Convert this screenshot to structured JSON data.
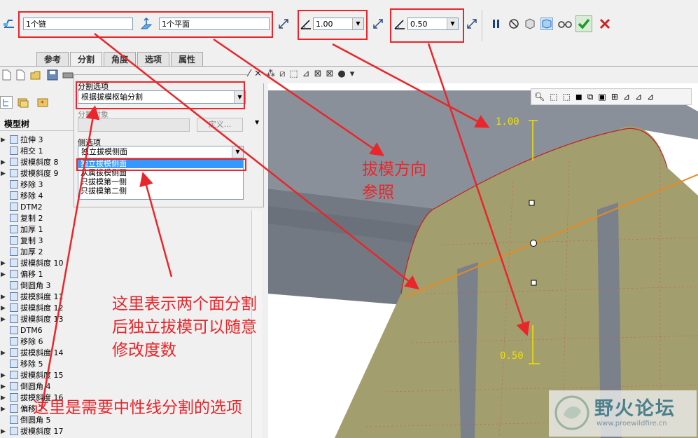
{
  "dashboard": {
    "chain_field": "1个链",
    "plane_field": "1个平面",
    "angle1": "1.00",
    "angle2": "0.50"
  },
  "tabs": [
    {
      "label": "参考"
    },
    {
      "label": "分割"
    },
    {
      "label": "角度"
    },
    {
      "label": "选项"
    },
    {
      "label": "属性"
    }
  ],
  "split_panel": {
    "split_options_label": "分割选项",
    "split_options_value": "根据拔模枢轴分割",
    "split_object_label": "分割对象",
    "define_button": "定义...",
    "side_options_label": "侧选项",
    "side_options_value": "独立拔模侧面",
    "side_options_list": [
      "独立拔模侧面",
      "从属拔模侧面",
      "只拔模第一侧",
      "只拔模第二侧"
    ]
  },
  "model_tree": {
    "title": "模型树",
    "items": [
      {
        "label": "拉伸 3",
        "expandable": true
      },
      {
        "label": "相交 1",
        "expandable": false
      },
      {
        "label": "拔模斜度 8",
        "expandable": true
      },
      {
        "label": "拔模斜度 9",
        "expandable": true
      },
      {
        "label": "移除 3",
        "expandable": false
      },
      {
        "label": "移除 4",
        "expandable": false
      },
      {
        "label": "DTM2",
        "expandable": false
      },
      {
        "label": "复制 2",
        "expandable": false
      },
      {
        "label": "加厚 1",
        "expandable": false
      },
      {
        "label": "复制 3",
        "expandable": false
      },
      {
        "label": "加厚 2",
        "expandable": false
      },
      {
        "label": "拔模斜度 10",
        "expandable": true
      },
      {
        "label": "偏移 1",
        "expandable": true
      },
      {
        "label": "倒圆角 3",
        "expandable": false
      },
      {
        "label": "拔模斜度 11",
        "expandable": true
      },
      {
        "label": "拔模斜度 12",
        "expandable": true
      },
      {
        "label": "拔模斜度 13",
        "expandable": true
      },
      {
        "label": "DTM6",
        "expandable": false
      },
      {
        "label": "移除 6",
        "expandable": false
      },
      {
        "label": "拔模斜度 14",
        "expandable": true
      },
      {
        "label": "移除 5",
        "expandable": false
      },
      {
        "label": "拔模斜度 15",
        "expandable": true
      },
      {
        "label": "倒圆角 4",
        "expandable": true
      },
      {
        "label": "拔模斜度 16",
        "expandable": true
      },
      {
        "label": "偏移 2",
        "expandable": true
      },
      {
        "label": "倒圆角 5",
        "expandable": false
      },
      {
        "label": "拔模斜度 17",
        "expandable": true
      }
    ]
  },
  "viewport": {
    "dim_top": "1.00",
    "dim_bottom": "0.50"
  },
  "annotations": {
    "draft_dir_line1": "拔模方向",
    "draft_dir_line2": "参照",
    "independent_line1": "这里表示两个面分割",
    "independent_line2": "后独立拔模可以随意",
    "independent_line3": "修改度数",
    "neutral_split": "这里是需要中性线分割的选项"
  },
  "watermark": {
    "text": "野火论坛",
    "url": "www.proewildfire.cn"
  },
  "colors": {
    "annotation_red": "#e8262b",
    "model_face": "#a39e6e",
    "model_gray": "#858b93",
    "dimension_yellow": "#eee000",
    "selection_blue": "#3399ff"
  }
}
